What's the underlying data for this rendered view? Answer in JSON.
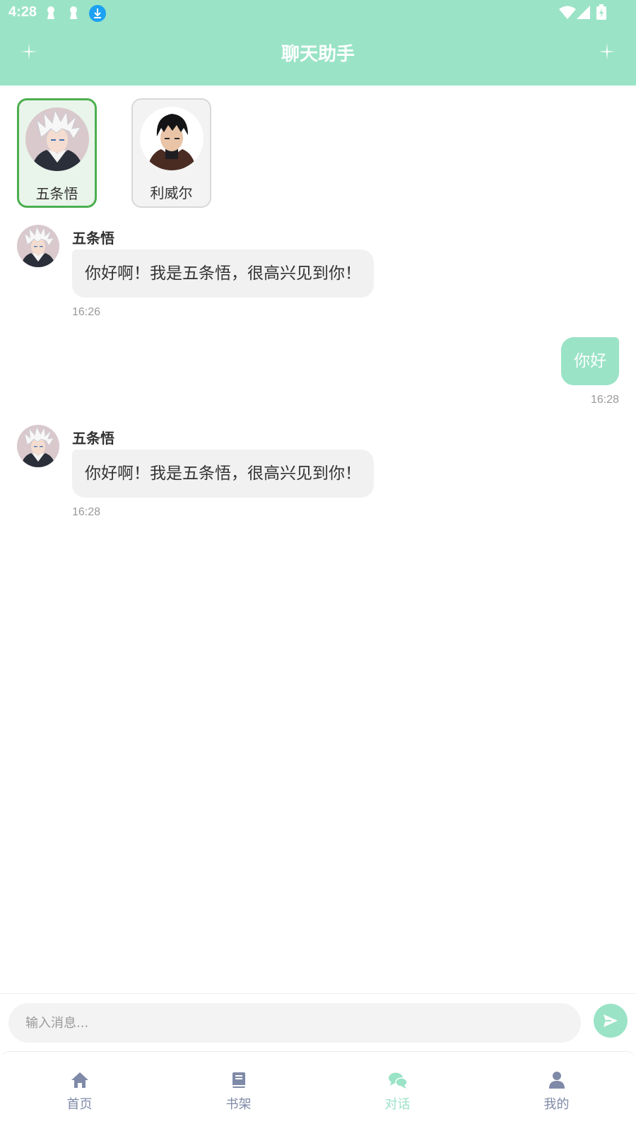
{
  "status_bar": {
    "time": "4:28"
  },
  "header": {
    "title": "聊天助手"
  },
  "characters": [
    {
      "name": "五条悟",
      "selected": true
    },
    {
      "name": "利威尔",
      "selected": false
    }
  ],
  "messages": [
    {
      "role": "bot",
      "sender": "五条悟",
      "text": "你好啊！我是五条悟，很高兴见到你！",
      "time": "16:26"
    },
    {
      "role": "user",
      "text": "你好",
      "time": "16:28"
    },
    {
      "role": "bot",
      "sender": "五条悟",
      "text": "你好啊！我是五条悟，很高兴见到你！",
      "time": "16:28"
    }
  ],
  "input": {
    "placeholder": "输入消息...",
    "value": ""
  },
  "tabs": [
    {
      "label": "首页",
      "icon": "home-icon",
      "active": false
    },
    {
      "label": "书架",
      "icon": "book-icon",
      "active": false
    },
    {
      "label": "对话",
      "icon": "chat-icon",
      "active": true
    },
    {
      "label": "我的",
      "icon": "user-icon",
      "active": false
    }
  ],
  "colors": {
    "accent": "#9ae3c7",
    "selected_border": "#4caf50",
    "tab_inactive": "#7f8aa8"
  }
}
